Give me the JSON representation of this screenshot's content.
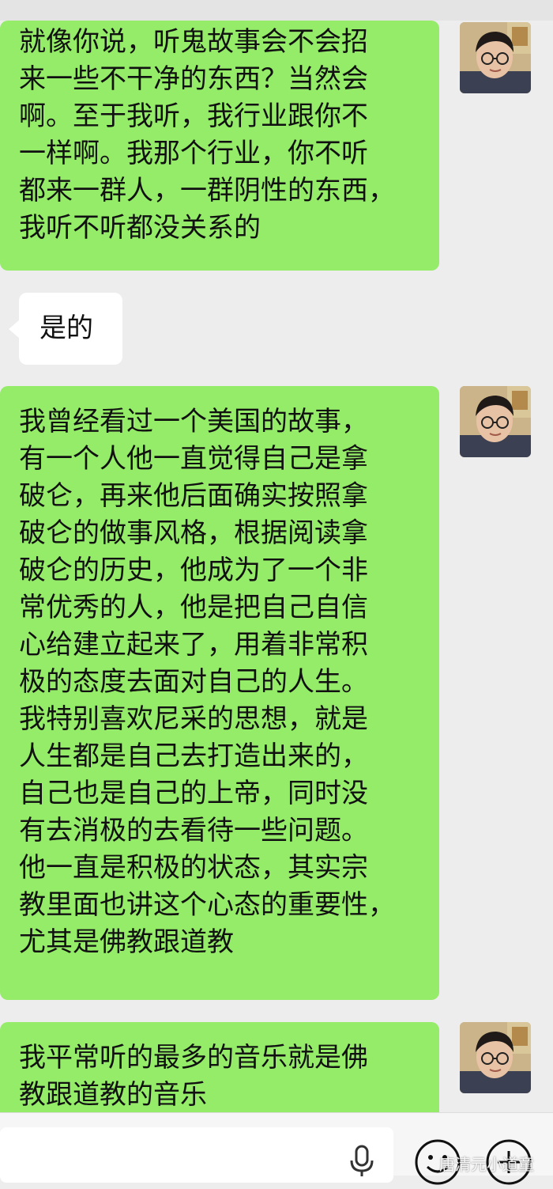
{
  "messages": [
    {
      "sender": "me",
      "text": "就像你说，听鬼故事会不会招\n来一些不干净的东西？当然会\n啊。至于我听，我行业跟你不\n一样啊。我那个行业，你不听\n都来一群人，一群阴性的东西，\n我听不听都没关系的"
    },
    {
      "sender": "other",
      "text": "是的"
    },
    {
      "sender": "me",
      "text": "我曾经看过一个美国的故事，\n有一个人他一直觉得自己是拿\n破仑，再来他后面确实按照拿\n破仑的做事风格，根据阅读拿\n破仑的历史，他成为了一个非\n常优秀的人，他是把自己自信\n心给建立起来了，用着非常积\n极的态度去面对自己的人生。\n我特别喜欢尼采的思想，就是\n人生都是自己去打造出来的，\n自己也是自己的上帝，同时没\n有去消极的去看待一些问题。\n他一直是积极的状态，其实宗\n教里面也讲这个心态的重要性，\n尤其是佛教跟道教"
    },
    {
      "sender": "me",
      "text": "我平常听的最多的音乐就是佛\n教跟道教的音乐"
    }
  ],
  "input_bar": {
    "icons": [
      "microphone-icon",
      "emoji-icon",
      "plus-icon"
    ]
  },
  "watermark": "唐清元小道童",
  "colors": {
    "background": "#ededed",
    "my_bubble": "#95ec69",
    "their_bubble": "#ffffff",
    "input_bar": "#f6f6f6"
  }
}
